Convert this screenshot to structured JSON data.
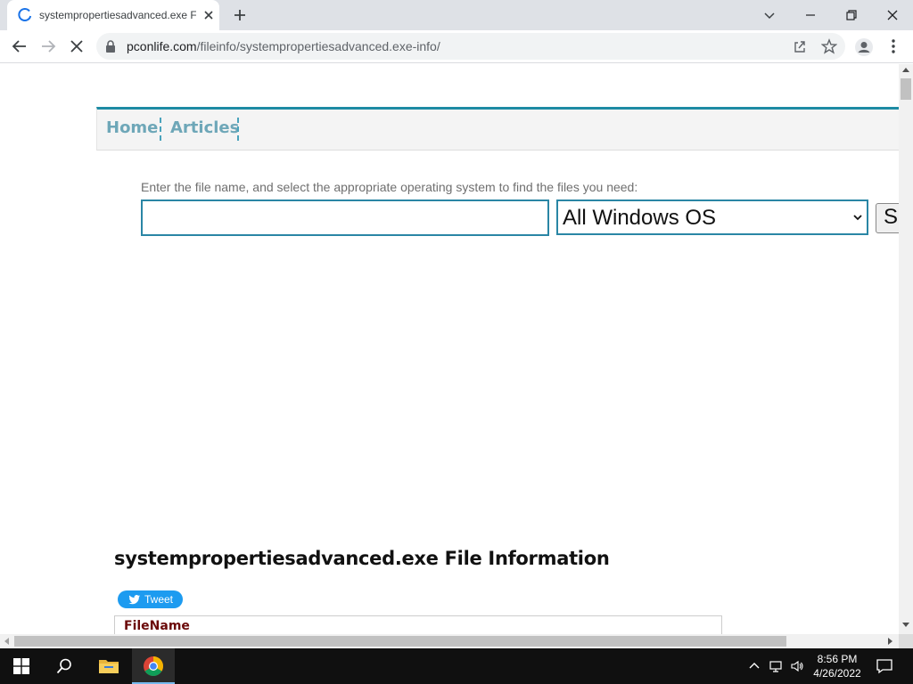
{
  "browser": {
    "tab_title": "systempropertiesadvanced.exe File Information",
    "url_host": "pconlife.com",
    "url_path": "/fileinfo/systempropertiesadvanced.exe-info/",
    "accent_color": "#1a73e8"
  },
  "nav": {
    "items": [
      {
        "label": "Home"
      },
      {
        "label": "Articles"
      }
    ],
    "accent_color": "#1d8ba4"
  },
  "search": {
    "hint": "Enter the file name, and select the appropriate operating system to find the files you need:",
    "input_value": "",
    "os_selected": "All Windows OS",
    "button_label": "S"
  },
  "content": {
    "heading": "systempropertiesadvanced.exe File Information",
    "tweet_label": "Tweet",
    "table_header": "FileName"
  },
  "taskbar": {
    "time": "8:56 PM",
    "date": "4/26/2022",
    "icons": [
      "windows-start-icon",
      "search-icon",
      "file-explorer-icon",
      "chrome-icon"
    ]
  }
}
